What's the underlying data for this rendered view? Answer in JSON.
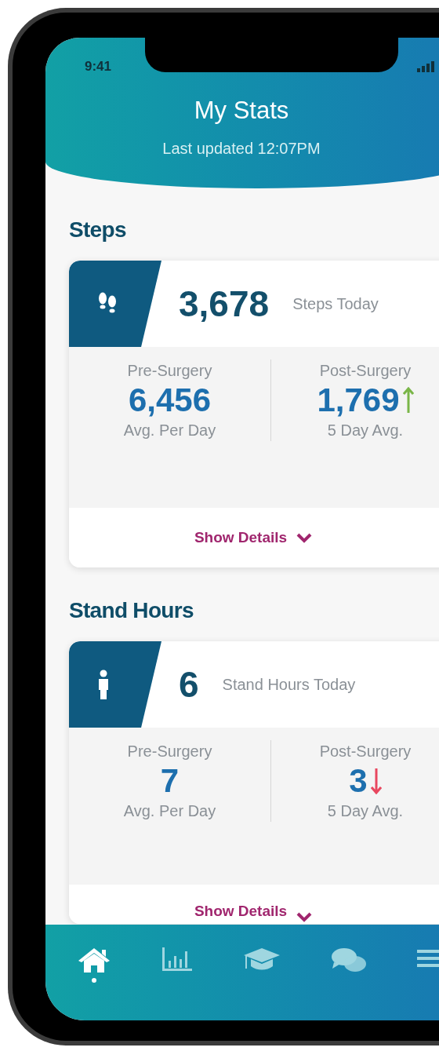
{
  "status_bar": {
    "time": "9:41"
  },
  "header": {
    "title": "My Stats",
    "subtitle": "Last updated 12:07PM"
  },
  "sections": [
    {
      "heading": "Steps",
      "kind": "steps",
      "today_value": "3,678",
      "today_label": "Steps Today",
      "pre": {
        "label": "Pre-Surgery",
        "value": "6,456",
        "caption": "Avg. Per Day"
      },
      "post": {
        "label": "Post-Surgery",
        "value": "1,769",
        "caption": "5 Day Avg.",
        "rising": true
      },
      "details_link": "Show Details"
    },
    {
      "heading": "Stand Hours",
      "kind": "stand",
      "today_value": "6",
      "today_label": "Stand Hours Today",
      "pre": {
        "label": "Pre-Surgery",
        "value": "7",
        "caption": "Avg. Per Day"
      },
      "post": {
        "label": "Post-Surgery",
        "value": "3",
        "caption": "5 Day Avg.",
        "rising": false
      },
      "details_link": "Show Details"
    }
  ],
  "tab_bar": [
    {
      "kind": "home",
      "selected": true
    },
    {
      "kind": "stats",
      "selected": false
    },
    {
      "kind": "learn",
      "selected": false
    },
    {
      "kind": "chat",
      "selected": false
    },
    {
      "kind": "menu",
      "selected": false
    }
  ]
}
